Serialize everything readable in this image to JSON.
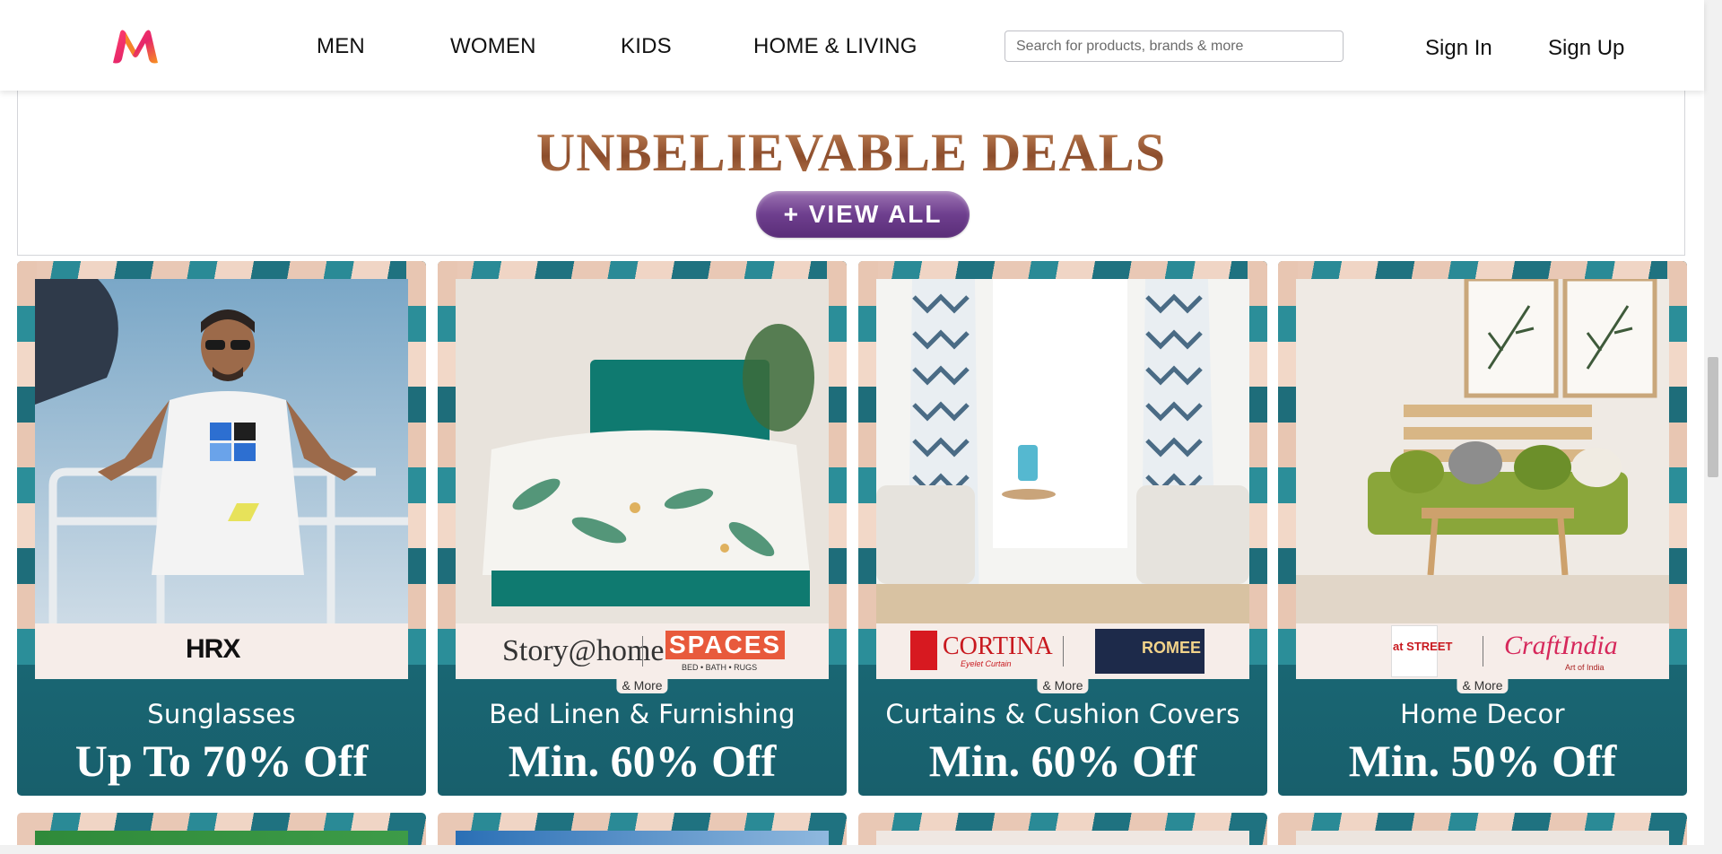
{
  "header": {
    "logo_alt": "Myntra",
    "nav": [
      "MEN",
      "WOMEN",
      "KIDS",
      "HOME & LIVING"
    ],
    "search_placeholder": "Search for products, brands & more",
    "sign_in": "Sign In",
    "sign_up": "Sign Up"
  },
  "deals": {
    "title": "UNBELIEVABLE DEALS",
    "view_all": "+ VIEW ALL"
  },
  "cards": [
    {
      "category": "Sunglasses",
      "offer": "Up To 70% Off",
      "brands": [
        "HRX"
      ],
      "more": ""
    },
    {
      "category": "Bed Linen & Furnishing",
      "offer": "Min. 60% Off",
      "brands": [
        "Story@home",
        "SPACES"
      ],
      "brand_sub": "BED • BATH • RUGS",
      "more": "& More"
    },
    {
      "category": "Curtains & Cushion Covers",
      "offer": "Min. 60% Off",
      "brands": [
        "CORTINA",
        "ROMEE"
      ],
      "brand_sub": "Eyelet Curtain",
      "more": "& More"
    },
    {
      "category": "Home Decor",
      "offer": "Min. 50% Off",
      "brands": [
        "at STREET",
        "CraftIndia"
      ],
      "brand_sub": "Art of India",
      "more": "& More"
    }
  ],
  "colors": {
    "accent_logo_pink": "#ff3f6c",
    "accent_logo_orange": "#f7931e",
    "deals_title": "#a7673f",
    "view_all_purple": "#6e3f8e",
    "card_teal": "#1b6f7c"
  }
}
